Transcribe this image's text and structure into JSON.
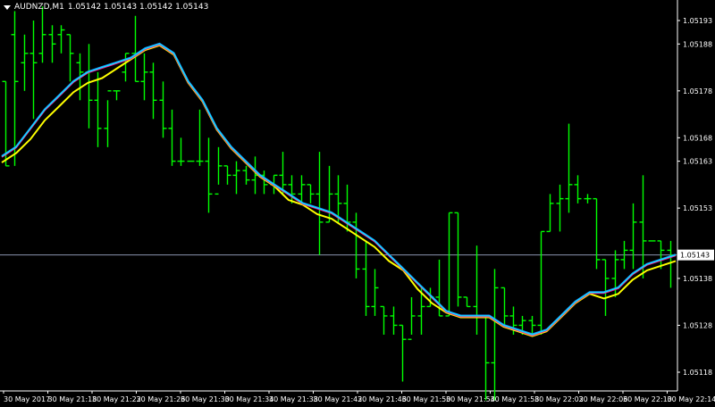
{
  "header": {
    "symbol": "AUDNZD,M1",
    "quote": "1.05142 1.05143 1.05142 1.05143"
  },
  "current_price": "1.05143",
  "colors": {
    "background": "#000000",
    "bars": "#00ff00",
    "axis": "#ffffff",
    "price_line": "#8a94b0",
    "ma_fast": "#1e90ff",
    "ma_mid": "#ff1493",
    "ma_slow": "#ffff00",
    "ma_cyan": "#00ffff"
  },
  "chart_data": {
    "type": "line",
    "price_axis_labels": [
      "1.05193",
      "1.05188",
      "1.05178",
      "1.05168",
      "1.05163",
      "1.05153",
      "1.05143",
      "1.05138",
      "1.05128",
      "1.05118"
    ],
    "time_axis_labels": [
      "30 May 2017",
      "30 May 21:18",
      "30 May 21:22",
      "30 May 21:26",
      "30 May 21:30",
      "30 May 21:34",
      "30 May 21:38",
      "30 May 21:42",
      "30 May 21:46",
      "30 May 21:50",
      "30 May 21:54",
      "30 May 21:58",
      "30 May 22:02",
      "30 May 22:06",
      "30 May 22:10",
      "30 May 22:14"
    ],
    "ylim": [
      1.05114,
      1.05197
    ],
    "bars": [
      [
        1.0518,
        1.05162,
        1.0518,
        1.05162
      ],
      [
        1.05195,
        1.05162,
        1.0519,
        1.0518
      ],
      [
        1.0519,
        1.05178,
        1.05184,
        1.05186
      ],
      [
        1.05193,
        1.05172,
        1.05186,
        1.05184
      ],
      [
        1.05196,
        1.05184,
        1.05186,
        1.0519
      ],
      [
        1.05192,
        1.05184,
        1.0519,
        1.05188
      ],
      [
        1.05192,
        1.05186,
        1.0519,
        1.05191
      ],
      [
        1.0519,
        1.0518,
        1.0519,
        1.05186
      ],
      [
        1.05186,
        1.05176,
        1.05184,
        1.05182
      ],
      [
        1.05188,
        1.0517,
        1.05182,
        1.05176
      ],
      [
        1.05182,
        1.05166,
        1.05176,
        1.0517
      ],
      [
        1.05176,
        1.05166,
        1.0517,
        1.05178
      ],
      [
        1.05178,
        1.05176,
        1.05178,
        1.05178
      ],
      [
        1.05186,
        1.0518,
        1.05182,
        1.05186
      ],
      [
        1.05194,
        1.0518,
        1.05186,
        1.0518
      ],
      [
        1.05186,
        1.05176,
        1.0518,
        1.05182
      ],
      [
        1.05184,
        1.05172,
        1.05182,
        1.05176
      ],
      [
        1.0518,
        1.05168,
        1.05176,
        1.0517
      ],
      [
        1.05174,
        1.05162,
        1.0517,
        1.05163
      ],
      [
        1.05168,
        1.05162,
        1.05163,
        1.05163
      ],
      [
        1.05163,
        1.05163,
        1.05163,
        1.05163
      ],
      [
        1.05174,
        1.05162,
        1.05163,
        1.05163
      ],
      [
        1.05168,
        1.05152,
        1.05163,
        1.05156
      ],
      [
        1.05166,
        1.05158,
        1.05156,
        1.05162
      ],
      [
        1.05162,
        1.05158,
        1.05162,
        1.0516
      ],
      [
        1.05163,
        1.05156,
        1.0516,
        1.05161
      ],
      [
        1.05162,
        1.05158,
        1.05161,
        1.05159
      ],
      [
        1.05164,
        1.05156,
        1.05159,
        1.0516
      ],
      [
        1.05161,
        1.05156,
        1.0516,
        1.05158
      ],
      [
        1.0516,
        1.05156,
        1.05158,
        1.0516
      ],
      [
        1.05165,
        1.05156,
        1.0516,
        1.05158
      ],
      [
        1.0516,
        1.05154,
        1.05158,
        1.05156
      ],
      [
        1.0516,
        1.05154,
        1.05156,
        1.05158
      ],
      [
        1.05158,
        1.05154,
        1.05158,
        1.05156
      ],
      [
        1.05165,
        1.05143,
        1.05156,
        1.0515
      ],
      [
        1.05162,
        1.0515,
        1.0515,
        1.05156
      ],
      [
        1.0516,
        1.0515,
        1.05156,
        1.05154
      ],
      [
        1.05158,
        1.05148,
        1.05154,
        1.0515
      ],
      [
        1.05152,
        1.05138,
        1.0515,
        1.0514
      ],
      [
        1.05146,
        1.0513,
        1.0514,
        1.05132
      ],
      [
        1.0514,
        1.0513,
        1.05132,
        1.05136
      ],
      [
        1.05132,
        1.05126,
        1.05132,
        1.0513
      ],
      [
        1.05132,
        1.05126,
        1.0513,
        1.05128
      ],
      [
        1.05128,
        1.05116,
        1.05128,
        1.05125
      ],
      [
        1.05134,
        1.05126,
        1.05125,
        1.0513
      ],
      [
        1.05136,
        1.05126,
        1.0513,
        1.05132
      ],
      [
        1.05136,
        1.05132,
        1.05132,
        1.05134
      ],
      [
        1.05142,
        1.0513,
        1.05134,
        1.0513
      ],
      [
        1.05152,
        1.0513,
        1.0513,
        1.05152
      ],
      [
        1.05152,
        1.05132,
        1.05152,
        1.05134
      ],
      [
        1.05134,
        1.05132,
        1.05134,
        1.05132
      ],
      [
        1.05145,
        1.05126,
        1.05132,
        1.0513
      ],
      [
        1.0513,
        1.05112,
        1.0513,
        1.0512
      ],
      [
        1.0514,
        1.05112,
        1.0512,
        1.05136
      ],
      [
        1.05136,
        1.05128,
        1.05136,
        1.0513
      ],
      [
        1.05132,
        1.05126,
        1.0513,
        1.05128
      ],
      [
        1.0513,
        1.05126,
        1.05128,
        1.05129
      ],
      [
        1.0513,
        1.05126,
        1.05129,
        1.05128
      ],
      [
        1.05148,
        1.05126,
        1.05128,
        1.05148
      ],
      [
        1.05156,
        1.05148,
        1.05148,
        1.05154
      ],
      [
        1.05158,
        1.05148,
        1.05154,
        1.05155
      ],
      [
        1.05171,
        1.05152,
        1.05155,
        1.05158
      ],
      [
        1.0516,
        1.05154,
        1.05158,
        1.05155
      ],
      [
        1.05156,
        1.05154,
        1.05155,
        1.05155
      ],
      [
        1.05155,
        1.0514,
        1.05155,
        1.05142
      ],
      [
        1.05142,
        1.0513,
        1.05142,
        1.05138
      ],
      [
        1.05144,
        1.05134,
        1.05138,
        1.05142
      ],
      [
        1.05146,
        1.0514,
        1.05142,
        1.05144
      ],
      [
        1.05154,
        1.0514,
        1.05144,
        1.0515
      ],
      [
        1.0516,
        1.05138,
        1.0515,
        1.05146
      ],
      [
        1.05146,
        1.05146,
        1.05146,
        1.05146
      ],
      [
        1.05146,
        1.0514,
        1.05146,
        1.05144
      ],
      [
        1.05146,
        1.05136,
        1.05144,
        1.05143
      ]
    ],
    "ma_fast": [
      1.05164,
      1.05166,
      1.0517,
      1.05174,
      1.05177,
      1.0518,
      1.05182,
      1.05183,
      1.05184,
      1.05185,
      1.05187,
      1.05188,
      1.05186,
      1.0518,
      1.05176,
      1.0517,
      1.05166,
      1.05163,
      1.0516,
      1.05158,
      1.05156,
      1.05154,
      1.05153,
      1.05152,
      1.0515,
      1.05148,
      1.05146,
      1.05143,
      1.0514,
      1.05137,
      1.05134,
      1.05131,
      1.0513,
      1.0513,
      1.0513,
      1.05128,
      1.05127,
      1.05126,
      1.05127,
      1.0513,
      1.05133,
      1.05135,
      1.05135,
      1.05136,
      1.05139,
      1.05141,
      1.05142,
      1.05143
    ],
    "ma_slow": [
      1.05163,
      1.05165,
      1.05168,
      1.05172,
      1.05175,
      1.05178,
      1.0518,
      1.05181,
      1.05183,
      1.05185,
      1.05187,
      1.05188,
      1.05186,
      1.0518,
      1.05176,
      1.0517,
      1.05166,
      1.05163,
      1.0516,
      1.05158,
      1.05155,
      1.05154,
      1.05152,
      1.05151,
      1.05149,
      1.05147,
      1.05145,
      1.05142,
      1.0514,
      1.05136,
      1.05133,
      1.05131,
      1.0513,
      1.0513,
      1.0513,
      1.05128,
      1.05127,
      1.05126,
      1.05127,
      1.0513,
      1.05133,
      1.05135,
      1.05134,
      1.05135,
      1.05138,
      1.0514,
      1.05141,
      1.05142
    ]
  }
}
